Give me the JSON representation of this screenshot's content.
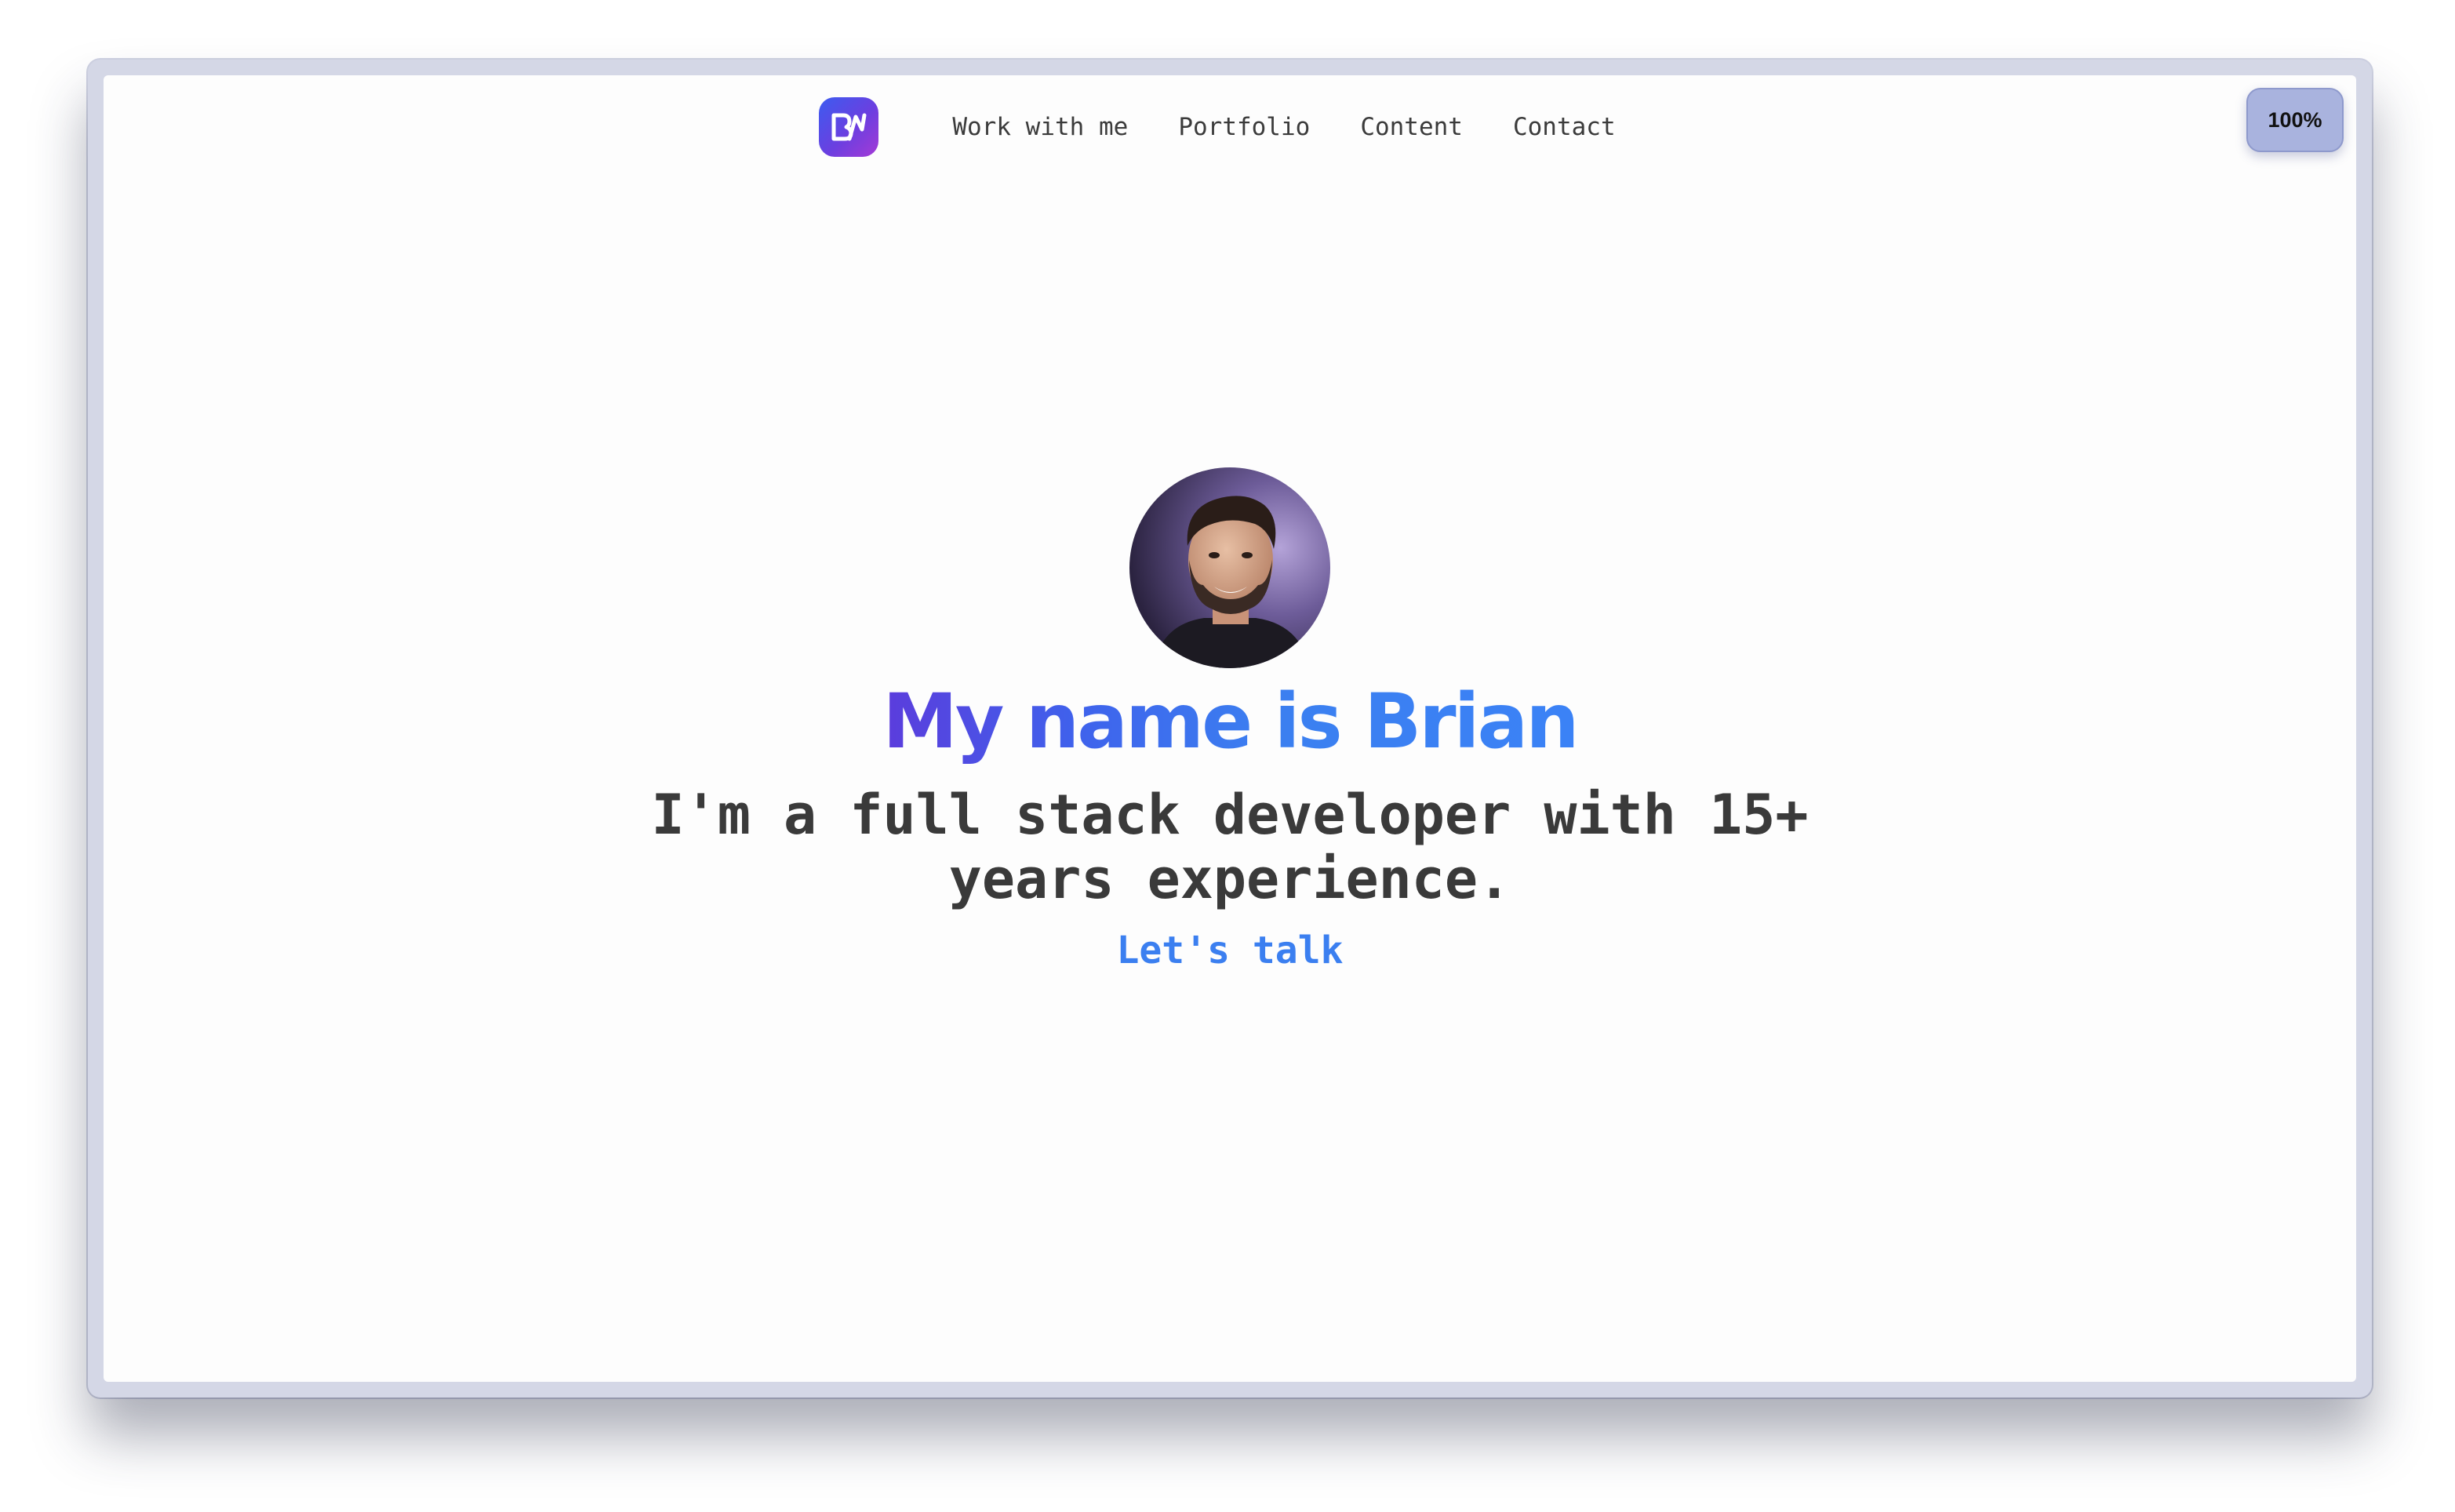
{
  "nav": {
    "logo_icon": "bm-monogram-logo-icon",
    "links": [
      {
        "label": "Work with me"
      },
      {
        "label": "Portfolio"
      },
      {
        "label": "Content"
      },
      {
        "label": "Contact"
      }
    ]
  },
  "zoom": {
    "label": "100%"
  },
  "hero": {
    "avatar_icon": "profile-photo-avatar",
    "title": "My name is Brian",
    "subtitle": "I'm a full stack developer with 15+ years experience.",
    "cta_label": "Let's talk"
  },
  "colors": {
    "accent_blue": "#3b82f6",
    "accent_purple": "#5b3cdc",
    "text_dark": "#3a3a3a",
    "zoom_badge": "#a9b3de"
  }
}
